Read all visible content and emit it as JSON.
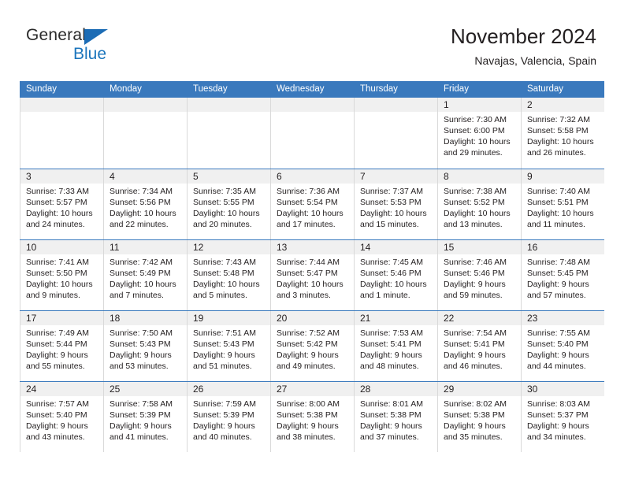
{
  "brand": {
    "name_part1": "General",
    "name_part2": "Blue",
    "accent_color": "#1b75bc",
    "triangle_color": "#1c6cb5"
  },
  "header": {
    "title": "November 2024",
    "location": "Navajas, Valencia, Spain"
  },
  "theme": {
    "header_row_bg": "#3a79bd",
    "daynum_band_bg": "#f0f0f0",
    "text_color": "#231f20",
    "grid_line_color": "#d9d9d9"
  },
  "calendar": {
    "weekday_headers": [
      "Sunday",
      "Monday",
      "Tuesday",
      "Wednesday",
      "Thursday",
      "Friday",
      "Saturday"
    ],
    "weeks": [
      [
        {
          "day": "",
          "sunrise": "",
          "sunset": "",
          "daylight_line1": "",
          "daylight_line2": "",
          "empty": true
        },
        {
          "day": "",
          "sunrise": "",
          "sunset": "",
          "daylight_line1": "",
          "daylight_line2": "",
          "empty": true
        },
        {
          "day": "",
          "sunrise": "",
          "sunset": "",
          "daylight_line1": "",
          "daylight_line2": "",
          "empty": true
        },
        {
          "day": "",
          "sunrise": "",
          "sunset": "",
          "daylight_line1": "",
          "daylight_line2": "",
          "empty": true
        },
        {
          "day": "",
          "sunrise": "",
          "sunset": "",
          "daylight_line1": "",
          "daylight_line2": "",
          "empty": true
        },
        {
          "day": "1",
          "sunrise": "Sunrise: 7:30 AM",
          "sunset": "Sunset: 6:00 PM",
          "daylight_line1": "Daylight: 10 hours",
          "daylight_line2": "and 29 minutes.",
          "empty": false
        },
        {
          "day": "2",
          "sunrise": "Sunrise: 7:32 AM",
          "sunset": "Sunset: 5:58 PM",
          "daylight_line1": "Daylight: 10 hours",
          "daylight_line2": "and 26 minutes.",
          "empty": false
        }
      ],
      [
        {
          "day": "3",
          "sunrise": "Sunrise: 7:33 AM",
          "sunset": "Sunset: 5:57 PM",
          "daylight_line1": "Daylight: 10 hours",
          "daylight_line2": "and 24 minutes.",
          "empty": false
        },
        {
          "day": "4",
          "sunrise": "Sunrise: 7:34 AM",
          "sunset": "Sunset: 5:56 PM",
          "daylight_line1": "Daylight: 10 hours",
          "daylight_line2": "and 22 minutes.",
          "empty": false
        },
        {
          "day": "5",
          "sunrise": "Sunrise: 7:35 AM",
          "sunset": "Sunset: 5:55 PM",
          "daylight_line1": "Daylight: 10 hours",
          "daylight_line2": "and 20 minutes.",
          "empty": false
        },
        {
          "day": "6",
          "sunrise": "Sunrise: 7:36 AM",
          "sunset": "Sunset: 5:54 PM",
          "daylight_line1": "Daylight: 10 hours",
          "daylight_line2": "and 17 minutes.",
          "empty": false
        },
        {
          "day": "7",
          "sunrise": "Sunrise: 7:37 AM",
          "sunset": "Sunset: 5:53 PM",
          "daylight_line1": "Daylight: 10 hours",
          "daylight_line2": "and 15 minutes.",
          "empty": false
        },
        {
          "day": "8",
          "sunrise": "Sunrise: 7:38 AM",
          "sunset": "Sunset: 5:52 PM",
          "daylight_line1": "Daylight: 10 hours",
          "daylight_line2": "and 13 minutes.",
          "empty": false
        },
        {
          "day": "9",
          "sunrise": "Sunrise: 7:40 AM",
          "sunset": "Sunset: 5:51 PM",
          "daylight_line1": "Daylight: 10 hours",
          "daylight_line2": "and 11 minutes.",
          "empty": false
        }
      ],
      [
        {
          "day": "10",
          "sunrise": "Sunrise: 7:41 AM",
          "sunset": "Sunset: 5:50 PM",
          "daylight_line1": "Daylight: 10 hours",
          "daylight_line2": "and 9 minutes.",
          "empty": false
        },
        {
          "day": "11",
          "sunrise": "Sunrise: 7:42 AM",
          "sunset": "Sunset: 5:49 PM",
          "daylight_line1": "Daylight: 10 hours",
          "daylight_line2": "and 7 minutes.",
          "empty": false
        },
        {
          "day": "12",
          "sunrise": "Sunrise: 7:43 AM",
          "sunset": "Sunset: 5:48 PM",
          "daylight_line1": "Daylight: 10 hours",
          "daylight_line2": "and 5 minutes.",
          "empty": false
        },
        {
          "day": "13",
          "sunrise": "Sunrise: 7:44 AM",
          "sunset": "Sunset: 5:47 PM",
          "daylight_line1": "Daylight: 10 hours",
          "daylight_line2": "and 3 minutes.",
          "empty": false
        },
        {
          "day": "14",
          "sunrise": "Sunrise: 7:45 AM",
          "sunset": "Sunset: 5:46 PM",
          "daylight_line1": "Daylight: 10 hours",
          "daylight_line2": "and 1 minute.",
          "empty": false
        },
        {
          "day": "15",
          "sunrise": "Sunrise: 7:46 AM",
          "sunset": "Sunset: 5:46 PM",
          "daylight_line1": "Daylight: 9 hours",
          "daylight_line2": "and 59 minutes.",
          "empty": false
        },
        {
          "day": "16",
          "sunrise": "Sunrise: 7:48 AM",
          "sunset": "Sunset: 5:45 PM",
          "daylight_line1": "Daylight: 9 hours",
          "daylight_line2": "and 57 minutes.",
          "empty": false
        }
      ],
      [
        {
          "day": "17",
          "sunrise": "Sunrise: 7:49 AM",
          "sunset": "Sunset: 5:44 PM",
          "daylight_line1": "Daylight: 9 hours",
          "daylight_line2": "and 55 minutes.",
          "empty": false
        },
        {
          "day": "18",
          "sunrise": "Sunrise: 7:50 AM",
          "sunset": "Sunset: 5:43 PM",
          "daylight_line1": "Daylight: 9 hours",
          "daylight_line2": "and 53 minutes.",
          "empty": false
        },
        {
          "day": "19",
          "sunrise": "Sunrise: 7:51 AM",
          "sunset": "Sunset: 5:43 PM",
          "daylight_line1": "Daylight: 9 hours",
          "daylight_line2": "and 51 minutes.",
          "empty": false
        },
        {
          "day": "20",
          "sunrise": "Sunrise: 7:52 AM",
          "sunset": "Sunset: 5:42 PM",
          "daylight_line1": "Daylight: 9 hours",
          "daylight_line2": "and 49 minutes.",
          "empty": false
        },
        {
          "day": "21",
          "sunrise": "Sunrise: 7:53 AM",
          "sunset": "Sunset: 5:41 PM",
          "daylight_line1": "Daylight: 9 hours",
          "daylight_line2": "and 48 minutes.",
          "empty": false
        },
        {
          "day": "22",
          "sunrise": "Sunrise: 7:54 AM",
          "sunset": "Sunset: 5:41 PM",
          "daylight_line1": "Daylight: 9 hours",
          "daylight_line2": "and 46 minutes.",
          "empty": false
        },
        {
          "day": "23",
          "sunrise": "Sunrise: 7:55 AM",
          "sunset": "Sunset: 5:40 PM",
          "daylight_line1": "Daylight: 9 hours",
          "daylight_line2": "and 44 minutes.",
          "empty": false
        }
      ],
      [
        {
          "day": "24",
          "sunrise": "Sunrise: 7:57 AM",
          "sunset": "Sunset: 5:40 PM",
          "daylight_line1": "Daylight: 9 hours",
          "daylight_line2": "and 43 minutes.",
          "empty": false
        },
        {
          "day": "25",
          "sunrise": "Sunrise: 7:58 AM",
          "sunset": "Sunset: 5:39 PM",
          "daylight_line1": "Daylight: 9 hours",
          "daylight_line2": "and 41 minutes.",
          "empty": false
        },
        {
          "day": "26",
          "sunrise": "Sunrise: 7:59 AM",
          "sunset": "Sunset: 5:39 PM",
          "daylight_line1": "Daylight: 9 hours",
          "daylight_line2": "and 40 minutes.",
          "empty": false
        },
        {
          "day": "27",
          "sunrise": "Sunrise: 8:00 AM",
          "sunset": "Sunset: 5:38 PM",
          "daylight_line1": "Daylight: 9 hours",
          "daylight_line2": "and 38 minutes.",
          "empty": false
        },
        {
          "day": "28",
          "sunrise": "Sunrise: 8:01 AM",
          "sunset": "Sunset: 5:38 PM",
          "daylight_line1": "Daylight: 9 hours",
          "daylight_line2": "and 37 minutes.",
          "empty": false
        },
        {
          "day": "29",
          "sunrise": "Sunrise: 8:02 AM",
          "sunset": "Sunset: 5:38 PM",
          "daylight_line1": "Daylight: 9 hours",
          "daylight_line2": "and 35 minutes.",
          "empty": false
        },
        {
          "day": "30",
          "sunrise": "Sunrise: 8:03 AM",
          "sunset": "Sunset: 5:37 PM",
          "daylight_line1": "Daylight: 9 hours",
          "daylight_line2": "and 34 minutes.",
          "empty": false
        }
      ]
    ]
  }
}
